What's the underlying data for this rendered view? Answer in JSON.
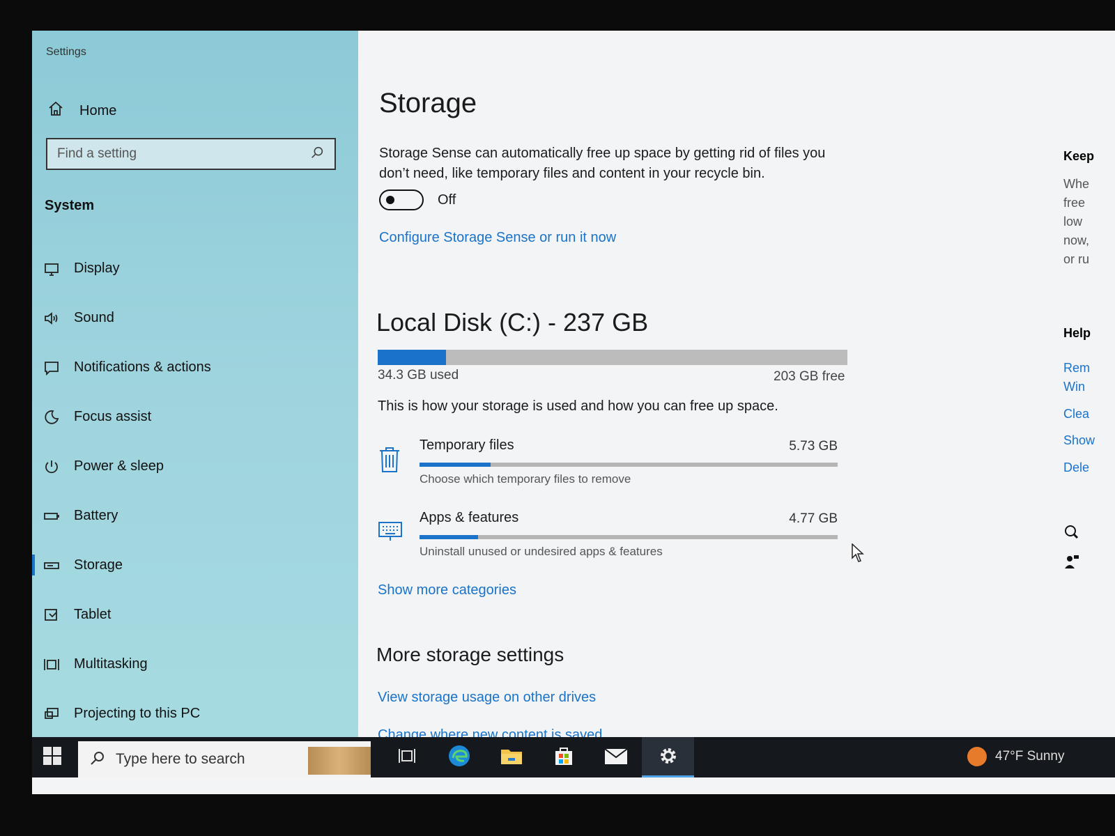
{
  "window": {
    "title": "Settings"
  },
  "sidebar": {
    "home_label": "Home",
    "search_placeholder": "Find a setting",
    "section_label": "System",
    "items": [
      {
        "label": "Display",
        "icon": "monitor-icon"
      },
      {
        "label": "Sound",
        "icon": "speaker-icon"
      },
      {
        "label": "Notifications & actions",
        "icon": "notification-icon"
      },
      {
        "label": "Focus assist",
        "icon": "moon-icon"
      },
      {
        "label": "Power & sleep",
        "icon": "power-icon"
      },
      {
        "label": "Battery",
        "icon": "battery-icon"
      },
      {
        "label": "Storage",
        "icon": "storage-icon",
        "active": true
      },
      {
        "label": "Tablet",
        "icon": "tablet-icon"
      },
      {
        "label": "Multitasking",
        "icon": "multitasking-icon"
      },
      {
        "label": "Projecting to this PC",
        "icon": "projecting-icon"
      }
    ]
  },
  "main": {
    "title": "Storage",
    "description": "Storage Sense can automatically free up space by getting rid of files you don’t need, like temporary files and content in your recycle bin.",
    "toggle_state": "Off",
    "configure_link": "Configure Storage Sense or run it now",
    "disk": {
      "title": "Local Disk (C:) - 237 GB",
      "used_label": "34.3 GB used",
      "free_label": "203 GB free",
      "used_fraction": 0.145,
      "how_text": "This is how your storage is used and how you can free up space."
    },
    "categories": [
      {
        "name": "Temporary files",
        "size": "5.73 GB",
        "sub": "Choose which temporary files to remove",
        "fraction": 0.17,
        "icon": "trash-icon"
      },
      {
        "name": "Apps & features",
        "size": "4.77 GB",
        "sub": "Uninstall unused or undesired apps & features",
        "fraction": 0.14,
        "icon": "keyboard-icon"
      }
    ],
    "more_categories_link": "Show more categories",
    "more_settings_title": "More storage settings",
    "view_usage_link": "View storage usage on other drives",
    "change_content_link": "Change where new content is saved"
  },
  "right_panel": {
    "keep_heading": "Keep",
    "keep_lines": [
      "Whe",
      "free",
      "low",
      "now,",
      "or ru"
    ],
    "help_heading": "Help",
    "help_links": [
      "Rem",
      "Win",
      "Clea",
      "Show",
      "Dele"
    ]
  },
  "taskbar": {
    "search_placeholder": "Type here to search",
    "weather_text": "47°F  Sunny"
  },
  "colors": {
    "accent": "#1a73c9",
    "sidebar_bg": "#9fd4de",
    "taskbar_bg": "#15181c"
  }
}
